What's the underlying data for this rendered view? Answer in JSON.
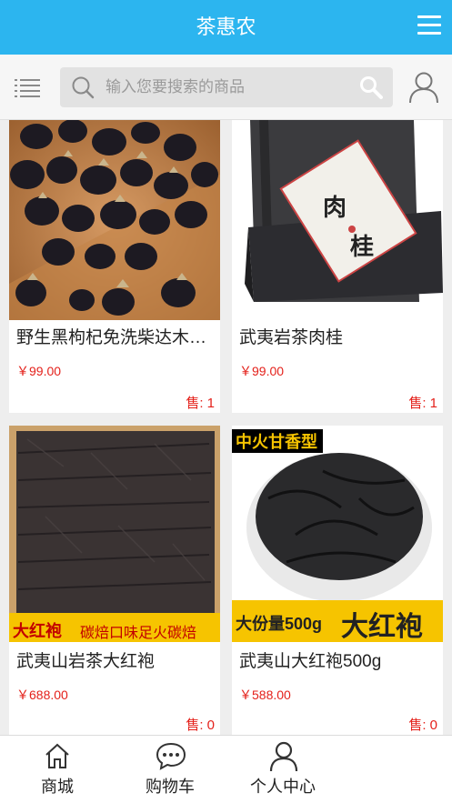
{
  "header": {
    "title": "茶惠农",
    "menu_icon": "hamburger-icon"
  },
  "search": {
    "placeholder": "输入您要搜索的商品",
    "left_icon": "list-icon",
    "search_icon": "search-icon",
    "submit_icon": "search-icon",
    "user_icon": "user-icon"
  },
  "products": [
    {
      "name": "野生黑枸杞免洗柴达木黑枸杞",
      "price": "￥99.00",
      "sold": "售: 1"
    },
    {
      "name": "武夷岩茶肉桂",
      "price": "￥99.00",
      "sold": "售: 1",
      "package_text": "肉桂"
    },
    {
      "name": "武夷山岩茶大红袍",
      "price": "￥688.00",
      "sold": "售: 0",
      "banner_left": "大红袍",
      "banner_right": "碳焙口味足火碳焙"
    },
    {
      "name": "武夷山大红袍500g",
      "price": "￥588.00",
      "sold": "售: 0",
      "tag_top": "中火甘香型",
      "banner_small": "大份量500g",
      "banner_large": "大红袍"
    }
  ],
  "tabbar": [
    {
      "label": "商城",
      "icon": "home-icon"
    },
    {
      "label": "购物车",
      "icon": "chat-icon"
    },
    {
      "label": "个人中心",
      "icon": "user-icon"
    }
  ],
  "colors": {
    "header": "#2cb5ef",
    "price": "#e4211b"
  }
}
